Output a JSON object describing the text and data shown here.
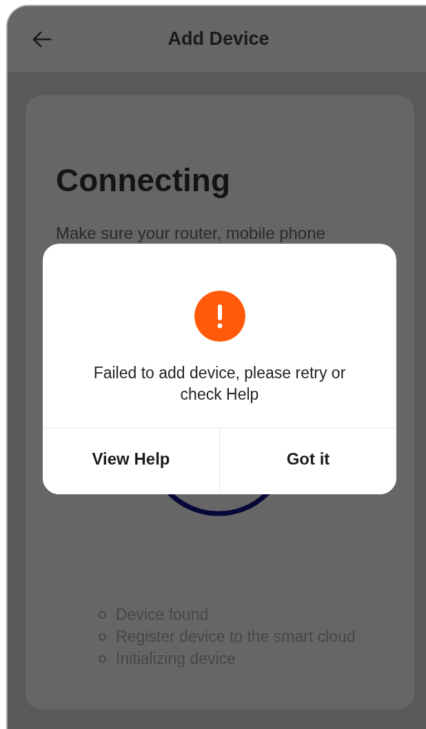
{
  "header": {
    "title": "Add Device"
  },
  "card": {
    "title": "Connecting",
    "description": "Make sure your router, mobile phone",
    "steps": [
      {
        "label": "Device found"
      },
      {
        "label": "Register device to the smart cloud"
      },
      {
        "label": "Initializing device"
      }
    ]
  },
  "dialog": {
    "message": "Failed to add device, please retry or check Help",
    "buttons": [
      {
        "label": "View Help"
      },
      {
        "label": "Got it"
      }
    ]
  }
}
